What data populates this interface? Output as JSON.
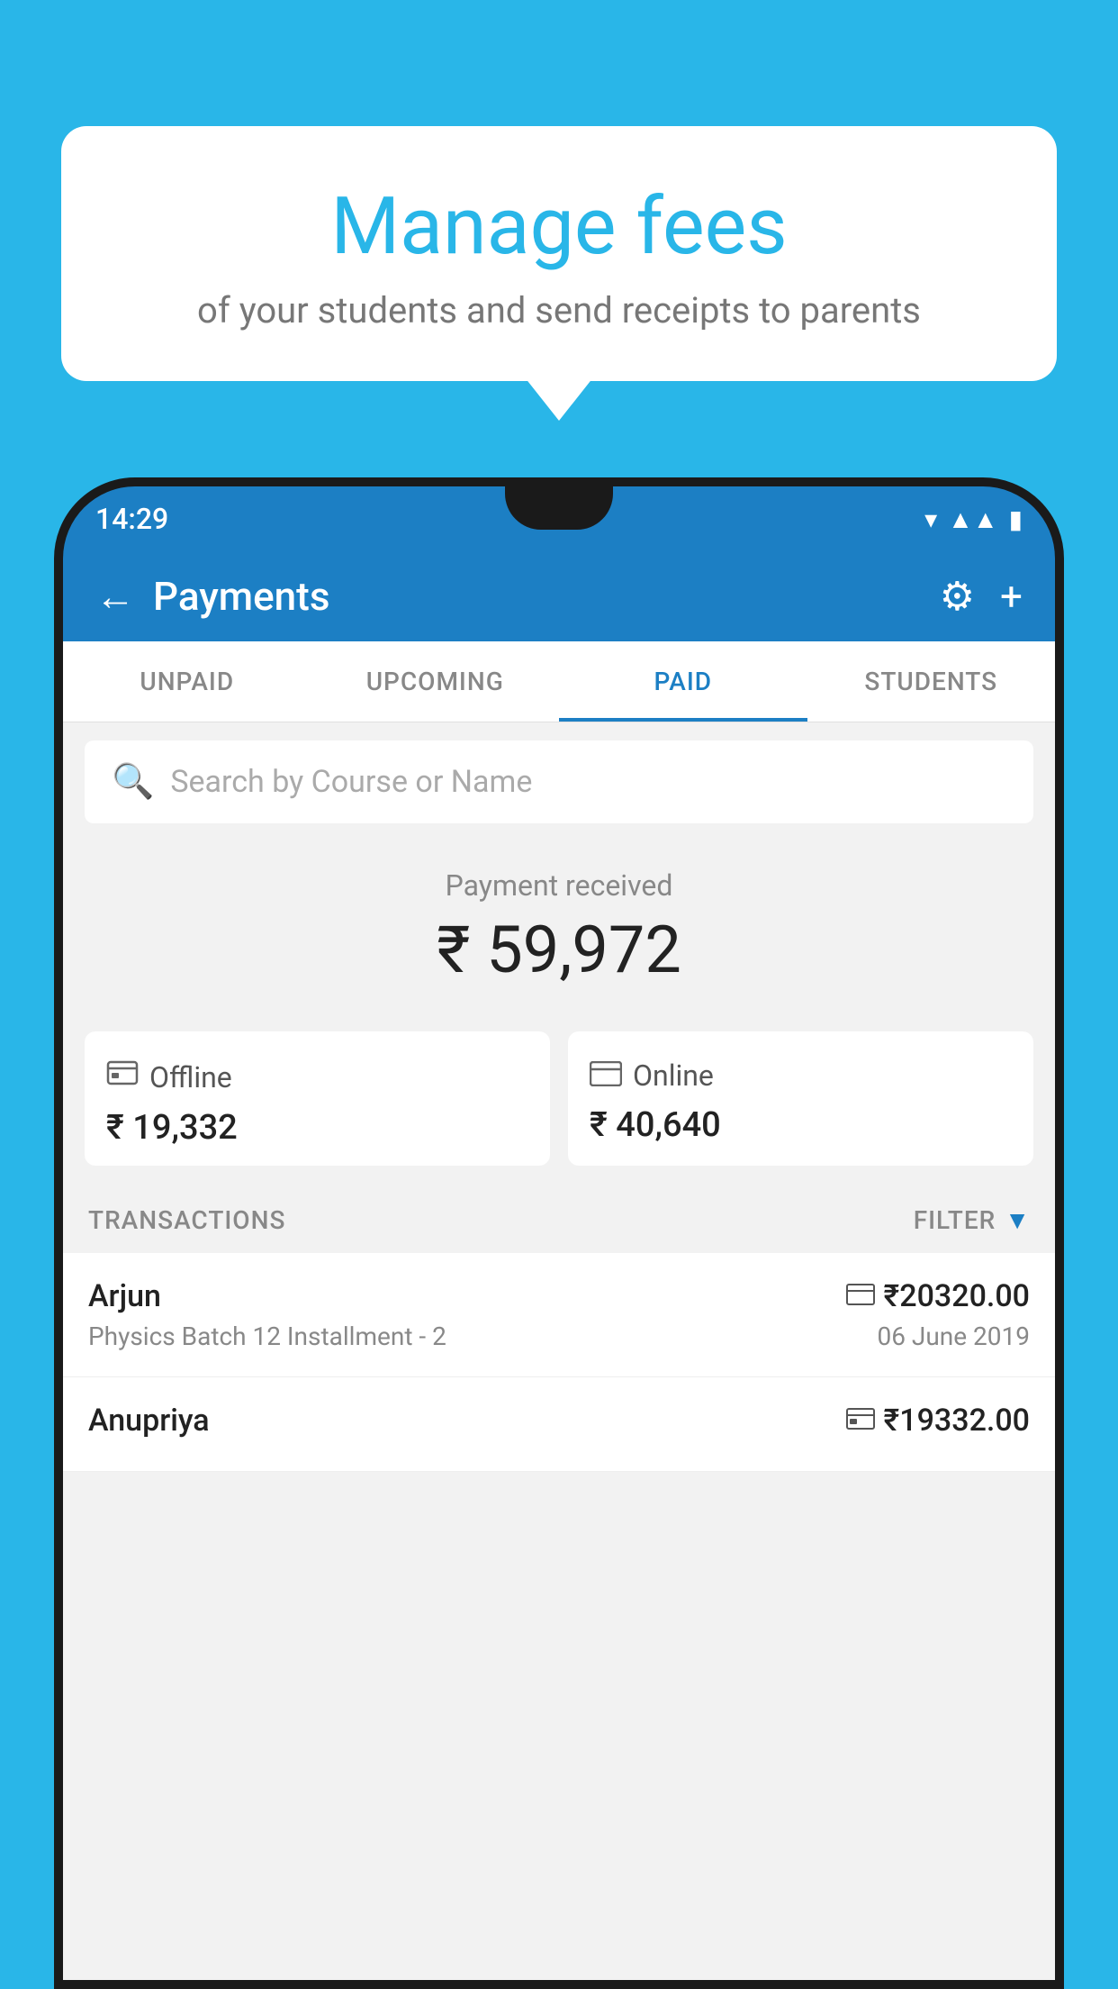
{
  "page": {
    "background_color": "#29b6e8"
  },
  "speech_bubble": {
    "title": "Manage fees",
    "subtitle": "of your students and send receipts to parents"
  },
  "status_bar": {
    "time": "14:29",
    "icons": [
      "wifi",
      "signal",
      "battery"
    ]
  },
  "app_header": {
    "title": "Payments",
    "back_label": "←",
    "gear_icon": "⚙",
    "plus_icon": "+"
  },
  "tabs": [
    {
      "label": "UNPAID",
      "active": false
    },
    {
      "label": "UPCOMING",
      "active": false
    },
    {
      "label": "PAID",
      "active": true
    },
    {
      "label": "STUDENTS",
      "active": false
    }
  ],
  "search": {
    "placeholder": "Search by Course or Name"
  },
  "payment_summary": {
    "label": "Payment received",
    "amount": "₹ 59,972",
    "offline": {
      "type": "Offline",
      "amount": "₹ 19,332"
    },
    "online": {
      "type": "Online",
      "amount": "₹ 40,640"
    }
  },
  "transactions": {
    "header": "TRANSACTIONS",
    "filter_label": "FILTER",
    "rows": [
      {
        "name": "Arjun",
        "amount": "₹20320.00",
        "course": "Physics Batch 12 Installment - 2",
        "date": "06 June 2019",
        "payment_type": "online"
      },
      {
        "name": "Anupriya",
        "amount": "₹19332.00",
        "course": "",
        "date": "",
        "payment_type": "offline"
      }
    ]
  }
}
